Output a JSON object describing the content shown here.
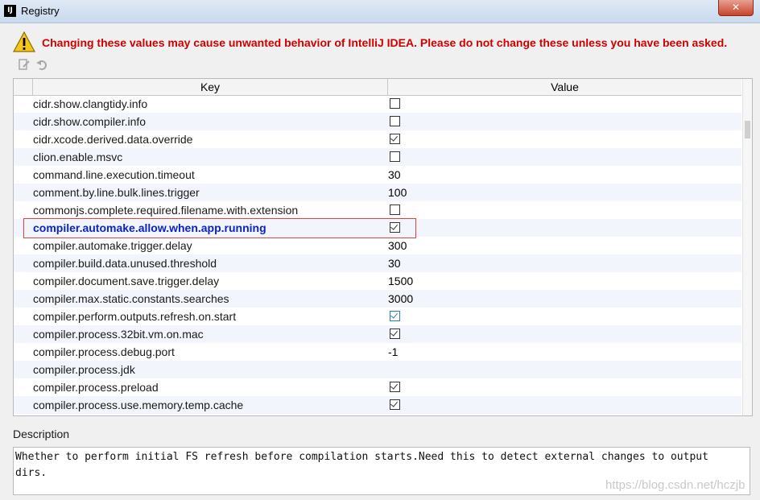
{
  "window": {
    "title": "Registry",
    "app_icon_text": "IJ",
    "close_label": "✕"
  },
  "warning": {
    "text": "Changing these values may cause unwanted behavior of IntelliJ IDEA. Please do not change these unless you have been asked."
  },
  "toolbar": {
    "edit_icon": "edit-icon",
    "revert_icon": "revert-icon"
  },
  "table": {
    "headers": {
      "key": "Key",
      "value": "Value"
    },
    "rows": [
      {
        "key": "cidr.show.clangtidy.info",
        "type": "bool",
        "checked": false
      },
      {
        "key": "cidr.show.compiler.info",
        "type": "bool",
        "checked": false
      },
      {
        "key": "cidr.xcode.derived.data.override",
        "type": "bool",
        "checked": true
      },
      {
        "key": "clion.enable.msvc",
        "type": "bool",
        "checked": false
      },
      {
        "key": "command.line.execution.timeout",
        "type": "text",
        "value": "30"
      },
      {
        "key": "comment.by.line.bulk.lines.trigger",
        "type": "text",
        "value": "100"
      },
      {
        "key": "commonjs.complete.required.filename.with.extension",
        "type": "bool",
        "checked": false
      },
      {
        "key": "compiler.automake.allow.when.app.running",
        "type": "bool",
        "checked": true,
        "highlight": true
      },
      {
        "key": "compiler.automake.trigger.delay",
        "type": "text",
        "value": "300"
      },
      {
        "key": "compiler.build.data.unused.threshold",
        "type": "text",
        "value": "30"
      },
      {
        "key": "compiler.document.save.trigger.delay",
        "type": "text",
        "value": "1500"
      },
      {
        "key": "compiler.max.static.constants.searches",
        "type": "text",
        "value": "3000"
      },
      {
        "key": "compiler.perform.outputs.refresh.on.start",
        "type": "bool",
        "checked": true,
        "blue": true
      },
      {
        "key": "compiler.process.32bit.vm.on.mac",
        "type": "bool",
        "checked": true
      },
      {
        "key": "compiler.process.debug.port",
        "type": "text",
        "value": "-1"
      },
      {
        "key": "compiler.process.jdk",
        "type": "text",
        "value": ""
      },
      {
        "key": "compiler.process.preload",
        "type": "bool",
        "checked": true
      },
      {
        "key": "compiler.process.use.memory.temp.cache",
        "type": "bool",
        "checked": true
      }
    ]
  },
  "description": {
    "label": "Description",
    "text": "Whether to perform initial FS refresh before compilation starts.Need this to detect external changes to output\ndirs."
  },
  "watermark": "https://blog.csdn.net/hczjb"
}
